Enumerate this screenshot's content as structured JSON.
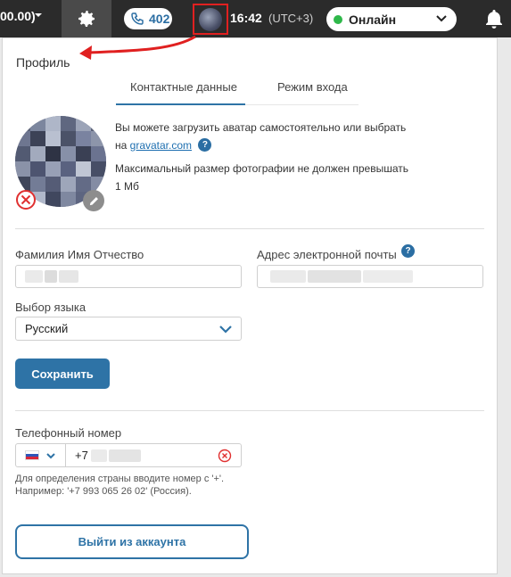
{
  "topbar": {
    "balance": "00.00)",
    "calls_count": "402",
    "clock": "16:42",
    "timezone": "(UTC+3)",
    "status": "Онлайн",
    "status_color": "#2fb84a",
    "icons": [
      "chevron-down-icon",
      "gear-icon",
      "phone-icon",
      "avatar",
      "bell-icon"
    ]
  },
  "profile": {
    "title": "Профиль",
    "tabs": [
      {
        "label": "Контактные данные",
        "active": true
      },
      {
        "label": "Режим входа",
        "active": false
      }
    ],
    "avatar": {
      "upload_text": "Вы можете загрузить аватар самостоятельно или выбрать",
      "upload_text_prefix": "на",
      "gravatar_link": "gravatar.com",
      "help": "?",
      "max_size_text": "Максимальный размер фотографии не должен превышать",
      "max_size_value": "1 Мб"
    },
    "form": {
      "fullname_label": "Фамилия Имя Отчество",
      "email_label": "Адрес электронной почты",
      "email_help": "?",
      "language_label": "Выбор языка",
      "language_value": "Русский",
      "save_label": "Сохранить"
    },
    "phone": {
      "label": "Телефонный номер",
      "prefix": "+7",
      "hint": "Для определения страны вводите номер с '+'. Например: '+7 993 065 26 02' (Россия)."
    },
    "logout_label": "Выйти из аккаунта"
  },
  "colors": {
    "accent": "#2e73a6",
    "topbar_bg": "#2b2b2b",
    "highlight_red": "#e02020"
  }
}
